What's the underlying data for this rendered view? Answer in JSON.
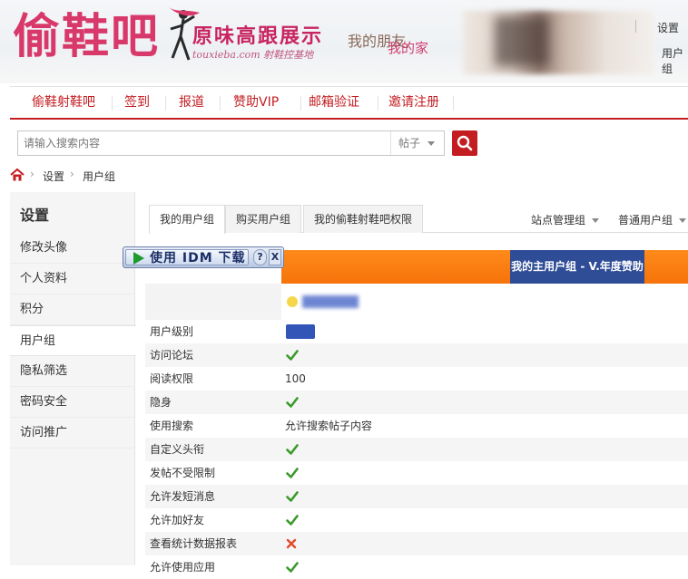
{
  "header": {
    "logo_text": "偷鞋吧",
    "slogan": "原味高跟展示",
    "site_url": "touxieba.com 射鞋控基地",
    "tagline_1": "我的朋友,",
    "tagline_2": "我的家",
    "settings_link": "设置",
    "usergroup_link": "用户组"
  },
  "nav": {
    "items": [
      {
        "label": "偷鞋射鞋吧"
      },
      {
        "label": "签到"
      },
      {
        "label": "报道"
      },
      {
        "label": "赞助VIP"
      },
      {
        "label": "邮箱验证"
      },
      {
        "label": "邀请注册"
      }
    ]
  },
  "search": {
    "placeholder": "请输入搜索内容",
    "type": "帖子"
  },
  "breadcrumb": {
    "items": [
      "设置",
      "用户组"
    ]
  },
  "sidebar": {
    "title": "设置",
    "items": [
      {
        "label": "修改头像"
      },
      {
        "label": "个人资料"
      },
      {
        "label": "积分"
      },
      {
        "label": "用户组"
      },
      {
        "label": "隐私筛选"
      },
      {
        "label": "密码安全"
      },
      {
        "label": "访问推广"
      }
    ]
  },
  "tabs": {
    "items": [
      {
        "label": "我的用户组"
      },
      {
        "label": "购买用户组"
      },
      {
        "label": "我的偷鞋射鞋吧权限"
      }
    ],
    "right_1": "站点管理组",
    "right_2": "普通用户组"
  },
  "idm": {
    "label": "使用 IDM 下载",
    "help": "?",
    "close": "X"
  },
  "table": {
    "header_group": "我的主用户组 - V.年度赞助",
    "rows": [
      {
        "label": "用户级别",
        "type": "badge"
      },
      {
        "label": "访问论坛",
        "type": "check"
      },
      {
        "label": "阅读权限",
        "type": "text",
        "value": "100"
      },
      {
        "label": "隐身",
        "type": "check"
      },
      {
        "label": "使用搜索",
        "type": "text",
        "value": "允许搜索帖子内容"
      },
      {
        "label": "自定义头衔",
        "type": "check"
      },
      {
        "label": "发帖不受限制",
        "type": "check"
      },
      {
        "label": "允许发短消息",
        "type": "check"
      },
      {
        "label": "允许加好友",
        "type": "check"
      },
      {
        "label": "查看统计数据报表",
        "type": "cross"
      },
      {
        "label": "允许使用应用",
        "type": "check"
      }
    ]
  },
  "colors": {
    "brand_red": "#c31d22",
    "orange": "#f5730a",
    "blue": "#2f4c96",
    "check_green": "#3a9a2a",
    "cross_red": "#e04a2a"
  }
}
